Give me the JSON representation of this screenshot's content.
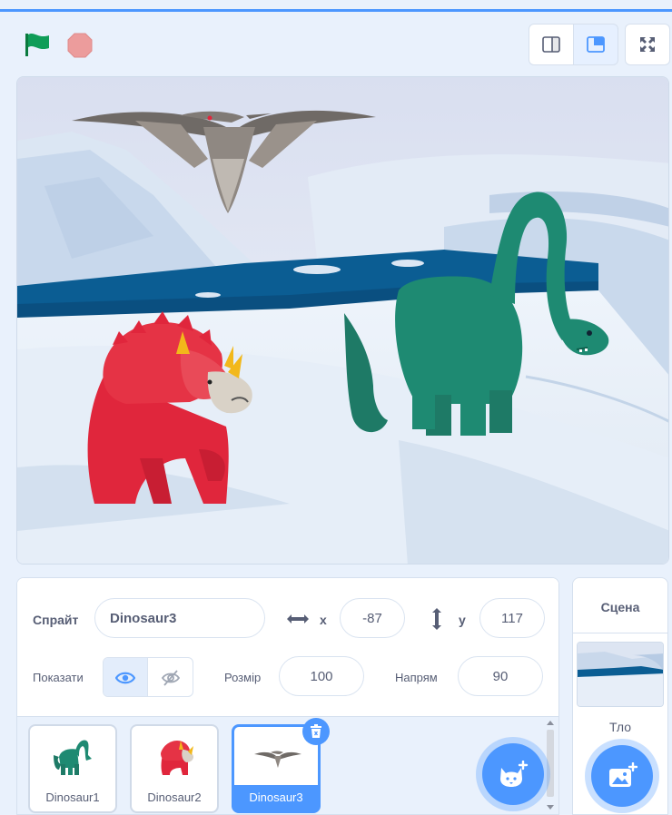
{
  "controls": {
    "flag": "green-flag",
    "stop": "stop-sign",
    "modes": [
      "small-stage",
      "normal-stage",
      "fullscreen"
    ]
  },
  "sprite_info": {
    "sprite_label": "Спрайт",
    "sprite_name": "Dinosaur3",
    "x_label": "x",
    "x_value": "-87",
    "y_label": "y",
    "y_value": "117",
    "show_label": "Показати",
    "size_label": "Розмір",
    "size_value": "100",
    "direction_label": "Напрям",
    "direction_value": "90"
  },
  "sprites": [
    {
      "name": "Dinosaur1",
      "selected": false
    },
    {
      "name": "Dinosaur2",
      "selected": false
    },
    {
      "name": "Dinosaur3",
      "selected": true
    }
  ],
  "stage_panel": {
    "title": "Сцена",
    "backdrops_label": "Тло"
  },
  "colors": {
    "accent": "#4c97ff",
    "flag": "#0f9d58",
    "stop": "#ec9c9c",
    "dino_green": "#1e8a72",
    "dino_red": "#e0263c"
  }
}
